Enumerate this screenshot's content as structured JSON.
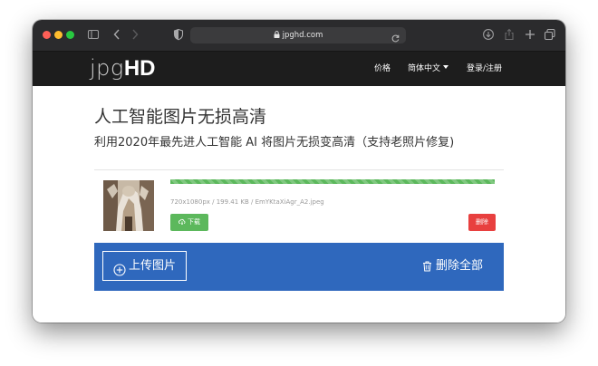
{
  "browser": {
    "url": "jpghd.com"
  },
  "site": {
    "logo_thin": "jpg",
    "logo_bold": "HD"
  },
  "nav": {
    "price": "价格",
    "language": "简体中文",
    "login": "登录/注册"
  },
  "main": {
    "title": "人工智能图片无损高清",
    "subtitle": "利用2020年最先进人工智能 AI 将图片无损变高清（支持老照片修复)"
  },
  "upload_item": {
    "progress": 1.0,
    "meta": "720x1080px / 199.41 KB / EmYKtaXiAgr_A2.jpeg",
    "download_label": "下载",
    "delete_label": "删除"
  },
  "actions": {
    "upload_label": "上传图片",
    "delete_all_label": "删除全部"
  },
  "colors": {
    "navbar": "#1d1d1d",
    "progress": "#5cb85c",
    "download": "#5cb85c",
    "delete": "#e8403f",
    "upload_bar": "#2f68bd"
  }
}
